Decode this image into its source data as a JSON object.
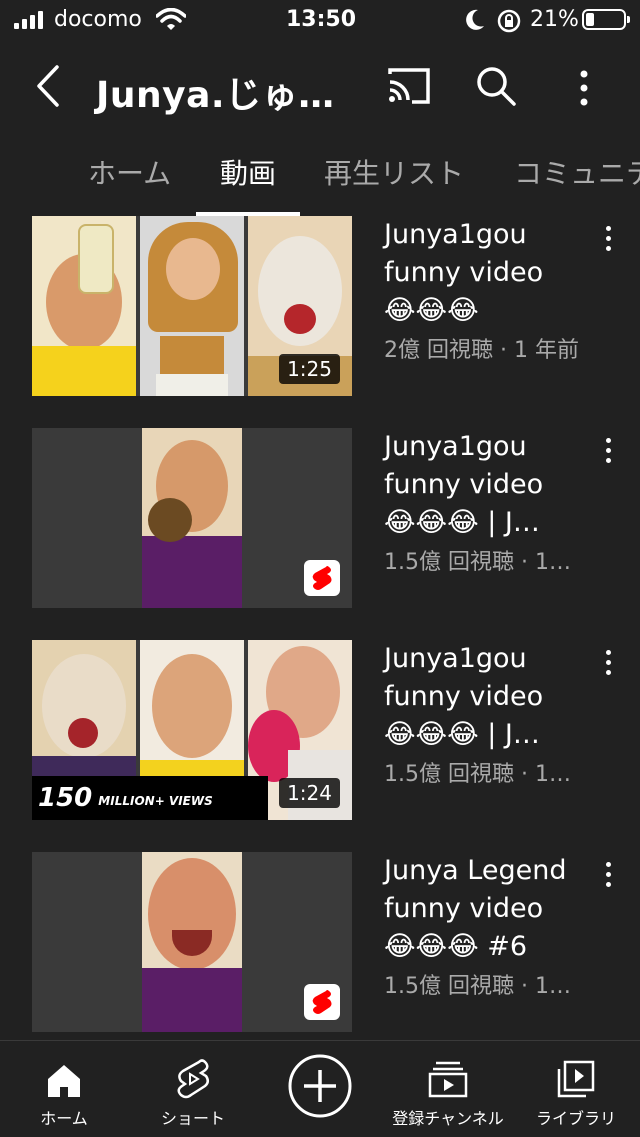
{
  "status_bar": {
    "carrier": "docomo",
    "time": "13:50",
    "battery": "21%"
  },
  "header": {
    "channel_title": "Junya.じゅ…"
  },
  "tabs": [
    {
      "label": "ホーム",
      "active": false
    },
    {
      "label": "動画",
      "active": true
    },
    {
      "label": "再生リスト",
      "active": false
    },
    {
      "label": "コミュニテ",
      "active": false
    }
  ],
  "videos": [
    {
      "title_line1": "Junya1gou",
      "title_line2": "funny video",
      "title_line3": "😂😂😂",
      "info": "2億 回視聴 · 1 年前",
      "duration": "1:25",
      "kind": "video"
    },
    {
      "title_line1": "Junya1gou",
      "title_line2": "funny video",
      "title_line3": "😂😂😂 | J…",
      "info": "1.5億 回視聴 · 1…",
      "duration": "",
      "kind": "short"
    },
    {
      "title_line1": "Junya1gou",
      "title_line2": "funny video",
      "title_line3": "😂😂😂 | J…",
      "info": "1.5億 回視聴 · 1…",
      "duration": "1:24",
      "kind": "video",
      "banner_big": "150",
      "banner_small": "MILLION+ VIEWS"
    },
    {
      "title_line1": "Junya Legend",
      "title_line2": "funny video",
      "title_line3": "😂😂😂 #6",
      "info": "1.5億 回視聴 · 1…",
      "duration": "",
      "kind": "short"
    }
  ],
  "bottom_nav": [
    {
      "label": "ホーム",
      "icon": "home-icon"
    },
    {
      "label": "ショート",
      "icon": "shorts-icon"
    },
    {
      "label": "",
      "icon": "create-icon"
    },
    {
      "label": "登録チャンネル",
      "icon": "subscriptions-icon"
    },
    {
      "label": "ライブラリ",
      "icon": "library-icon"
    }
  ],
  "colors": {
    "background": "#212121",
    "text_primary": "#ffffff",
    "text_secondary": "#aaaaaa",
    "shorts_red": "#ff0000"
  }
}
